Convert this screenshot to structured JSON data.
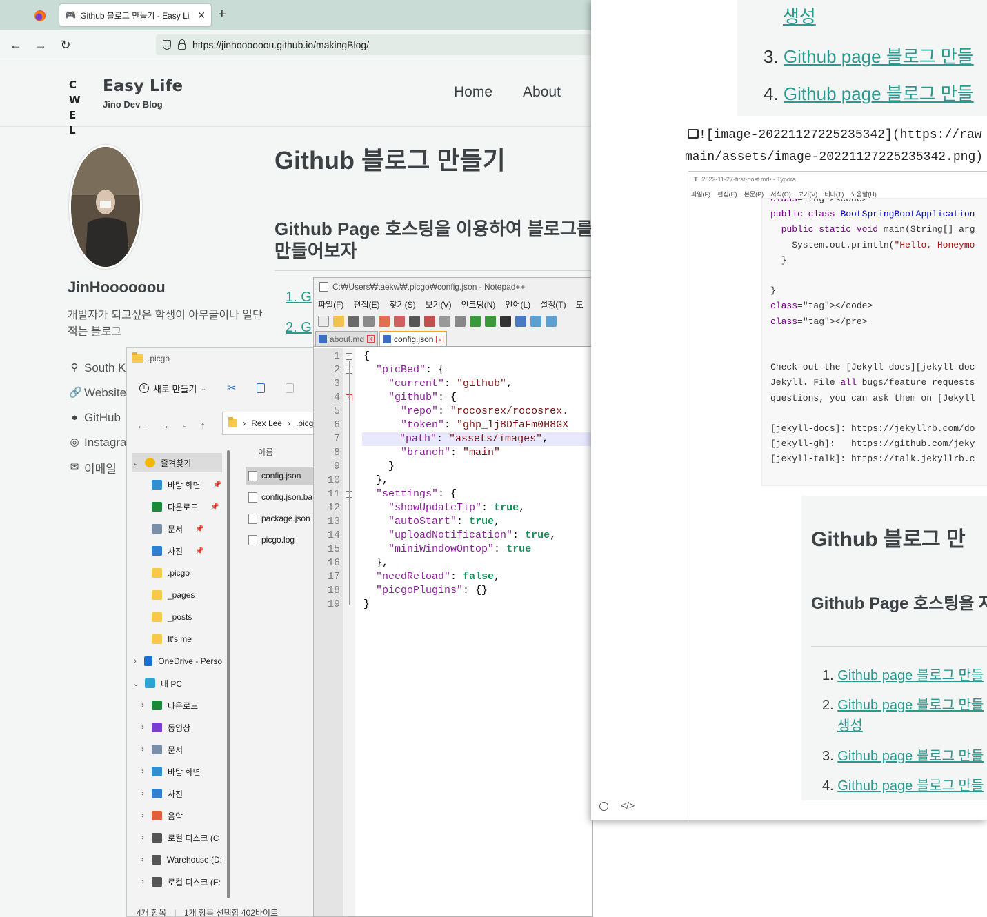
{
  "browser": {
    "tab_title": "Github 블로그 만들기 - Easy Li",
    "url": "https://jinhoooooou.github.io/makingBlog/"
  },
  "site": {
    "logo": "C W\nE L",
    "title": "Easy Life",
    "subtitle": "Jino Dev Blog",
    "nav": [
      "Home",
      "About"
    ],
    "author_name": "JinHoooooou",
    "author_bio": "개발자가 되고싶은 학생이 아무글이나 일단 적는 블로그",
    "links": [
      {
        "icon": "map-marker-icon",
        "label": "South Ko"
      },
      {
        "icon": "link-icon",
        "label": "Website"
      },
      {
        "icon": "github-icon",
        "label": "GitHub"
      },
      {
        "icon": "instagram-icon",
        "label": "Instagra"
      },
      {
        "icon": "envelope-icon",
        "label": "이메일"
      }
    ],
    "page_title": "Github 블로그 만들기",
    "page_h2": "Github Page 호스팅을 이용하여 블로그를 만들어보자",
    "toc": [
      "1. G",
      "2. G"
    ]
  },
  "explorer": {
    "title": ".picgo",
    "new_button": "새로 만들기",
    "breadcrumb": [
      "Rex Lee",
      ".picgo"
    ],
    "column_name": "이름",
    "nav": [
      {
        "label": "즐겨찾기",
        "level": 0,
        "chevron": "v",
        "icon": "star-icon",
        "selected": true
      },
      {
        "label": "바탕 화면",
        "level": 1,
        "icon": "desktop-icon",
        "pinned": true
      },
      {
        "label": "다운로드",
        "level": 1,
        "icon": "download-icon",
        "pinned": true
      },
      {
        "label": "문서",
        "level": 1,
        "icon": "document-icon",
        "pinned": true
      },
      {
        "label": "사진",
        "level": 1,
        "icon": "picture-icon",
        "pinned": true
      },
      {
        "label": ".picgo",
        "level": 1,
        "icon": "folder-icon"
      },
      {
        "label": "_pages",
        "level": 1,
        "icon": "folder-icon"
      },
      {
        "label": "_posts",
        "level": 1,
        "icon": "folder-icon"
      },
      {
        "label": "It's me",
        "level": 1,
        "icon": "folder-icon"
      },
      {
        "label": "OneDrive - Perso",
        "level": 0,
        "chevron": ">",
        "icon": "cloud-icon"
      },
      {
        "label": "내 PC",
        "level": 0,
        "chevron": "v",
        "icon": "pc-icon"
      },
      {
        "label": "다운로드",
        "level": 1,
        "chevron": ">",
        "icon": "download-icon"
      },
      {
        "label": "동영상",
        "level": 1,
        "chevron": ">",
        "icon": "video-icon"
      },
      {
        "label": "문서",
        "level": 1,
        "chevron": ">",
        "icon": "document-icon"
      },
      {
        "label": "바탕 화면",
        "level": 1,
        "chevron": ">",
        "icon": "desktop-icon"
      },
      {
        "label": "사진",
        "level": 1,
        "chevron": ">",
        "icon": "picture-icon"
      },
      {
        "label": "음악",
        "level": 1,
        "chevron": ">",
        "icon": "music-icon"
      },
      {
        "label": "로컬 디스크 (C",
        "level": 1,
        "chevron": ">",
        "icon": "drive-icon"
      },
      {
        "label": "Warehouse (D:",
        "level": 1,
        "chevron": ">",
        "icon": "drive-icon"
      },
      {
        "label": "로컬 디스크 (E:",
        "level": 1,
        "chevron": ">",
        "icon": "drive-icon"
      }
    ],
    "files": [
      {
        "name": "config.json",
        "selected": true
      },
      {
        "name": "config.json.ba"
      },
      {
        "name": "package.json"
      },
      {
        "name": "picgo.log"
      }
    ],
    "status_items": "4개 항목",
    "status_selected": "1개 항목 선택함 402바이트"
  },
  "notepad": {
    "title": "C:₩Users₩taekw₩.picgo₩config.json - Notepad++",
    "menu": [
      "파일(F)",
      "편집(E)",
      "찾기(S)",
      "보기(V)",
      "인코딩(N)",
      "언어(L)",
      "설정(T)",
      "도"
    ],
    "tabs": [
      {
        "name": "about.md",
        "active": false
      },
      {
        "name": "config.json",
        "active": true
      }
    ],
    "current_line": 7,
    "lines": [
      "{",
      "  \"picBed\": {",
      "    \"current\": \"github\",",
      "    \"github\": {",
      "      \"repo\": \"rocosrex/rocosrex.",
      "      \"token\": \"ghp_lj8DfaFm0H8GX",
      "      \"path\": \"assets/images\",",
      "      \"branch\": \"main\"",
      "    }",
      "  },",
      "  \"settings\": {",
      "    \"showUpdateTip\": true,",
      "    \"autoStart\": true,",
      "    \"uploadNotification\": true,",
      "    \"miniWindowOntop\": true",
      "  },",
      "  \"needReload\": false,",
      "  \"picgoPlugins\": {}",
      "}"
    ]
  },
  "typora": {
    "top_toc": [
      {
        "num": "",
        "text": "생성"
      },
      {
        "num": "3.",
        "text": "Github page 블로그 만들"
      },
      {
        "num": "4.",
        "text": "Github page 블로그 만들"
      }
    ],
    "md_line1": "![image-20221127225235342](https://raw",
    "md_line2": "main/assets/image-20221127225235342.png)",
    "shot_title": "2022-11-27-first-post.md• - Typora",
    "shot_menu": [
      "파일(F)",
      "편집(E)",
      "본문(P)",
      "서식(O)",
      "보기(V)",
      "테마(T)",
      "도움말(H)"
    ],
    "code_lines": [
      "<code>",
      "public class BootSpringBootApplication",
      "  public static void main(String[] arg",
      "    System.out.println(\"Hello, Honeymo",
      "  }",
      "",
      "}",
      "</code>",
      "</pre>",
      "",
      "",
      "Check out the [Jekyll docs][jekyll-doc",
      "Jekyll. File all bugs/feature requests",
      "questions, you can ask them on [Jekyll",
      "",
      "[jekyll-docs]: https://jekyllrb.com/do",
      "[jekyll-gh]:   https://github.com/jeky",
      "[jekyll-talk]: https://talk.jekyllrb.c"
    ],
    "inner_h1": "Github 블로그 만",
    "inner_h2": "Github Page 호스팅을 자",
    "inner_toc": [
      {
        "num": "1.",
        "text": "Github page 블로그 만들"
      },
      {
        "num": "2.",
        "text": "Github page 블로그 만들"
      },
      {
        "num": "",
        "text": "생성"
      },
      {
        "num": "3.",
        "text": "Github page 블로그 만들"
      },
      {
        "num": "4.",
        "text": "Github page 블로그 만들"
      }
    ]
  }
}
